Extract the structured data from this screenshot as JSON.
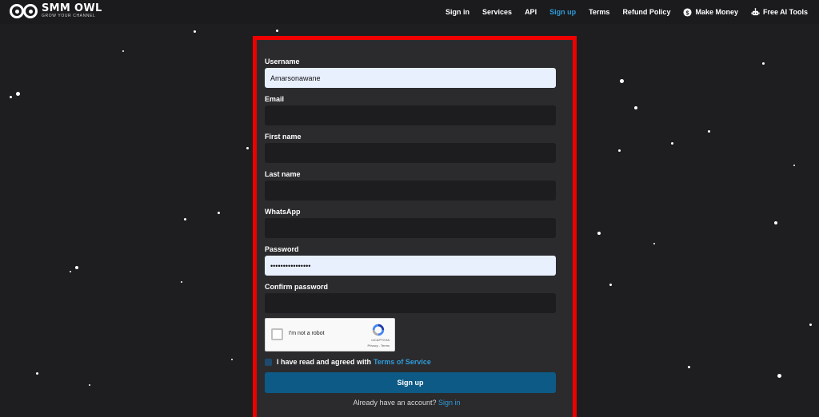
{
  "brand": {
    "name": "SMM OWL",
    "tagline": "GROW YOUR CHANNEL"
  },
  "nav": {
    "items": [
      {
        "label": "Sign in",
        "active": false
      },
      {
        "label": "Services",
        "active": false
      },
      {
        "label": "API",
        "active": false
      },
      {
        "label": "Sign up",
        "active": true
      },
      {
        "label": "Terms",
        "active": false
      },
      {
        "label": "Refund Policy",
        "active": false
      },
      {
        "label": "Make Money",
        "active": false,
        "icon": "dollar-coin-icon"
      },
      {
        "label": "Free AI Tools",
        "active": false,
        "icon": "robot-icon"
      }
    ]
  },
  "form": {
    "username": {
      "label": "Username",
      "value": "Amarsonawane"
    },
    "email": {
      "label": "Email",
      "value": ""
    },
    "first_name": {
      "label": "First name",
      "value": ""
    },
    "last_name": {
      "label": "Last name",
      "value": ""
    },
    "whatsapp": {
      "label": "WhatsApp",
      "value": ""
    },
    "password": {
      "label": "Password",
      "value": "••••••••••••••••"
    },
    "confirm_password": {
      "label": "Confirm password",
      "value": ""
    },
    "recaptcha": {
      "label": "I'm not a robot",
      "brand": "reCAPTCHA",
      "links": "Privacy - Terms"
    },
    "agree": {
      "text": "I have read and agreed with",
      "link": "Terms of Service"
    },
    "submit_label": "Sign up",
    "have_account": {
      "text": "Already have an account?",
      "link": "Sign in"
    }
  },
  "colors": {
    "accent": "#2f9bd9",
    "button": "#0d5a87",
    "highlight_border": "#ef0000",
    "background": "#1e1e21"
  }
}
